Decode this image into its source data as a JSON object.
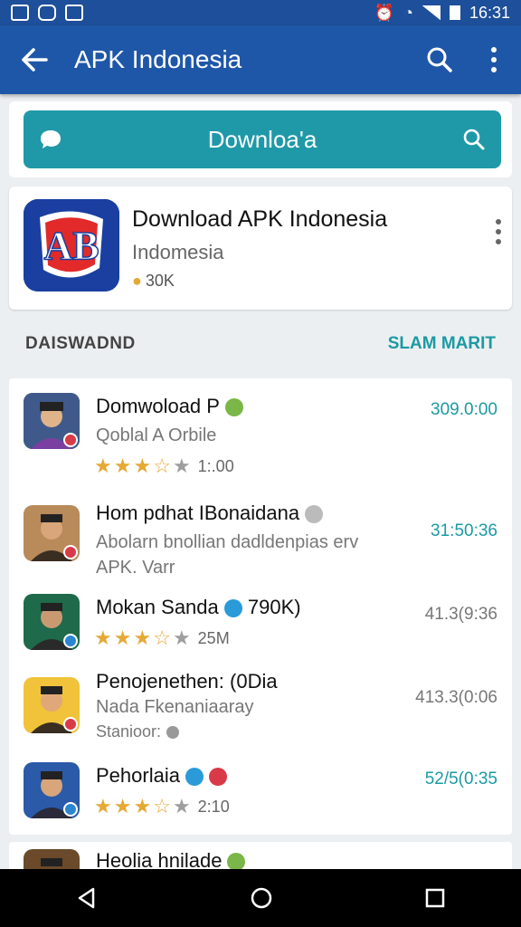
{
  "status": {
    "time": "16:31"
  },
  "appbar": {
    "title": "APK Indonesia"
  },
  "search": {
    "text": "Downloa'a"
  },
  "featured": {
    "title": "Download APK Indonesia",
    "subtitle": "Indomesia",
    "count": "30K",
    "logo_text": "AB"
  },
  "section": {
    "left": "DAISWADND",
    "right": "SLAM MARIT"
  },
  "items": [
    {
      "name": "Domwoload P",
      "sub": "Qoblal A Orbile",
      "rating": 3.5,
      "meta": "1:.00",
      "time": "309.0:00"
    },
    {
      "name": "Hom pdhat IBonaidana",
      "sub": "Abolarn bnollian dadldenpias erv",
      "sub2": "APK. Varr",
      "time": "31:50:36"
    },
    {
      "name": "Mokan Sanda",
      "tag": "790K)",
      "rating": 3.5,
      "meta": "25M",
      "time": "41.3(9:36"
    },
    {
      "name": "Penojenethen: (0Dia",
      "sub": "Nada Fkenaniaaray",
      "sub2": "Stanioor:",
      "time": "413.3(0:06"
    },
    {
      "name": "Pehorlaia",
      "rating": 3.5,
      "meta": "2:10",
      "time": "52/5(0:35"
    },
    {
      "name": "Heolia hnilade",
      "time": ""
    }
  ],
  "colors": {
    "primary": "#1f57a8",
    "accent": "#1f99a8",
    "star": "#e5a935"
  }
}
